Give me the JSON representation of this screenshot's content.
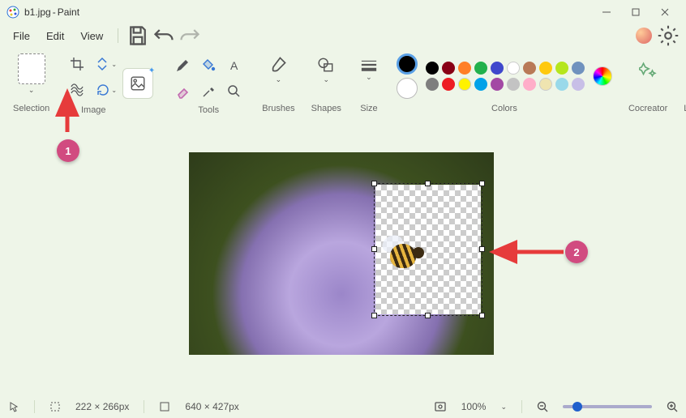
{
  "window": {
    "filename": "b1.jpg",
    "app": "Paint"
  },
  "menu": {
    "file": "File",
    "edit": "Edit",
    "view": "View"
  },
  "ribbon": {
    "selection": "Selection",
    "image": "Image",
    "tools": "Tools",
    "brushes": "Brushes",
    "shapes": "Shapes",
    "size": "Size",
    "colors": "Colors",
    "cocreator": "Cocreator",
    "layers": "Layers"
  },
  "palette_row1": [
    "#000000",
    "#7e7e7e",
    "#880015",
    "#ed1c24",
    "#ff7f27",
    "#fff200",
    "#22b14c",
    "#00a2e8",
    "#3f48cc",
    "#a349a4"
  ],
  "palette_row2": [
    "#ffffff",
    "#c3c3c3",
    "#b97a57",
    "#ffaec9",
    "#ffc90e",
    "#efe4b0",
    "#b5e61d",
    "#99d9ea",
    "#7092be",
    "#c8bfe7"
  ],
  "current_color1": "#000000",
  "current_color2": "#ffffff",
  "status": {
    "cursor_icon": "cursor",
    "selection_size": "222 × 266px",
    "canvas_size": "640 × 427px",
    "zoom": "100%"
  },
  "callouts": {
    "c1": "1",
    "c2": "2"
  }
}
